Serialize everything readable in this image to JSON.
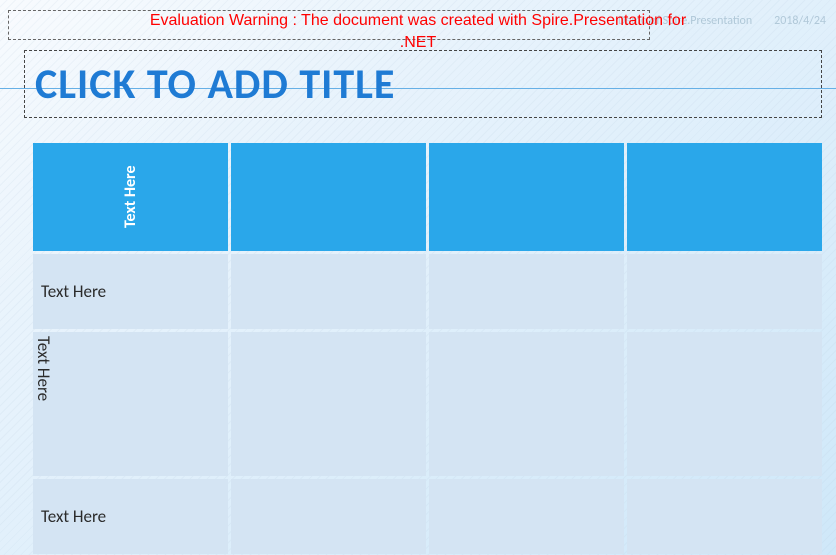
{
  "meta": {
    "label": "Demo of Spire.Presentation",
    "date": "2018/4/24"
  },
  "watermark": {
    "line1": "Evaluation Warning : The document was created with Spire.Presentation for",
    "line2": ".NET"
  },
  "title": {
    "placeholder": "CLICK TO ADD TITLE"
  },
  "table": {
    "rows": [
      {
        "type": "header",
        "first_cell": {
          "text": "Text Here",
          "orient": "vertical_white"
        }
      },
      {
        "type": "data",
        "first_cell": {
          "text": "Text Here",
          "orient": "horizontal"
        }
      },
      {
        "type": "data_tall",
        "first_cell": {
          "text": "Text Here",
          "orient": "vertical_dark"
        }
      },
      {
        "type": "data",
        "first_cell": {
          "text": "Text Here",
          "orient": "horizontal"
        }
      }
    ]
  }
}
